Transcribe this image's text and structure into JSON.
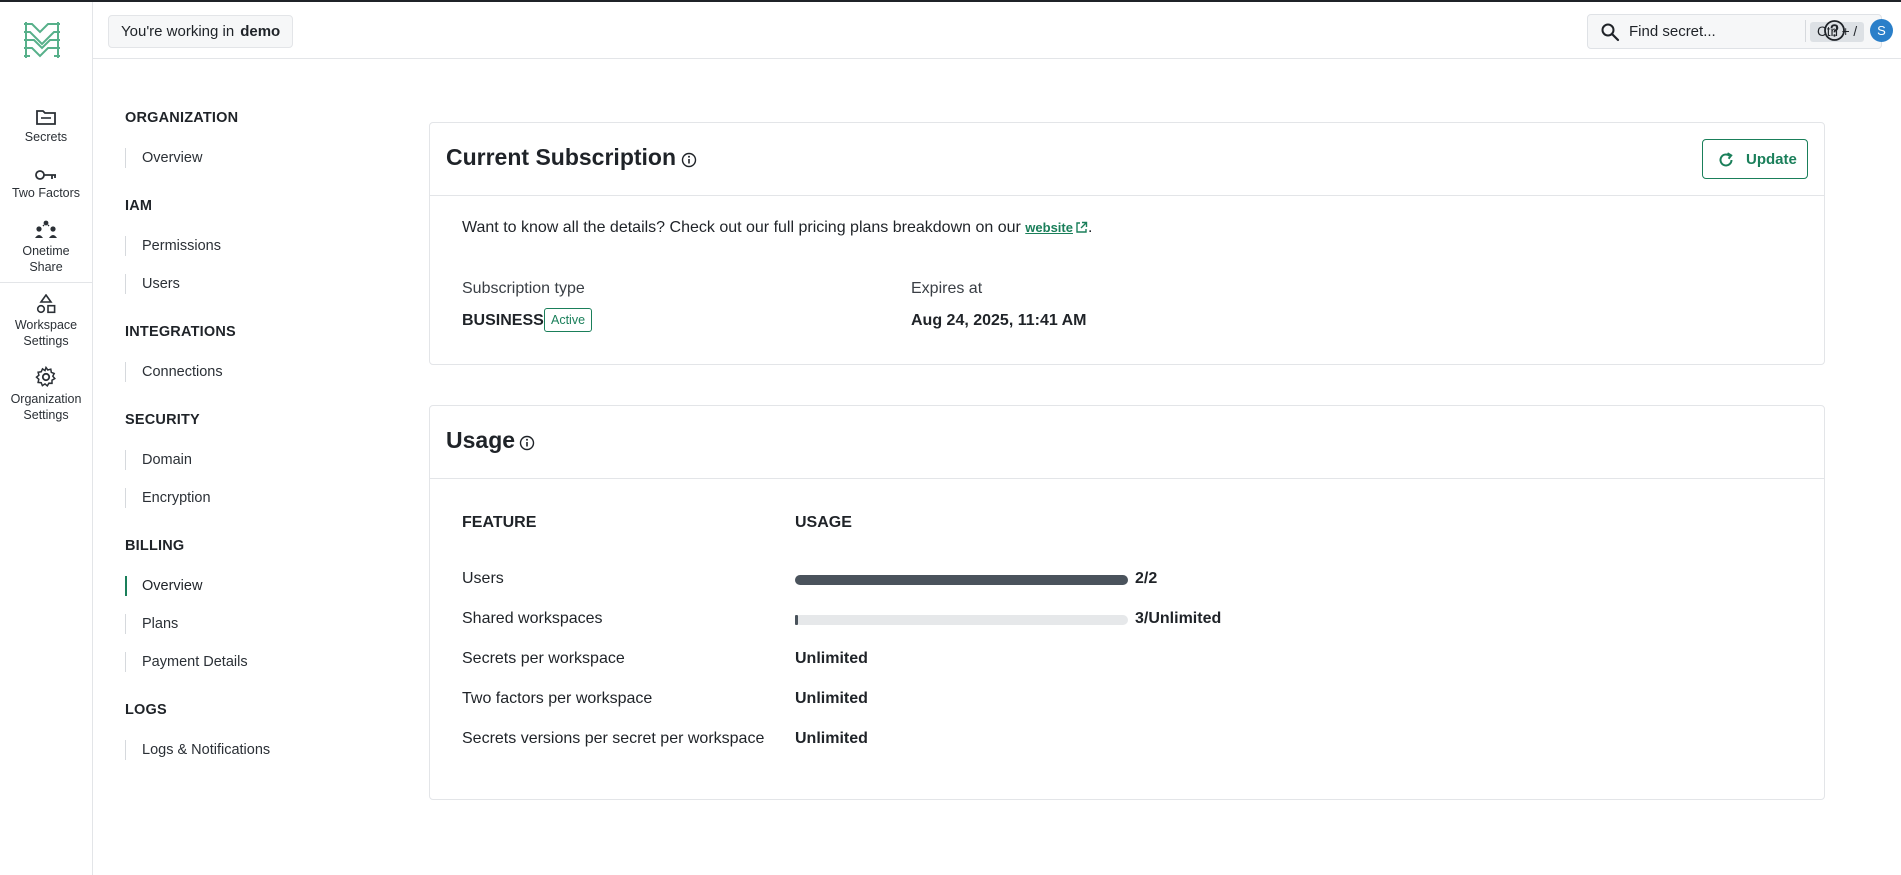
{
  "header": {
    "workspace_prefix": "You're working in",
    "workspace_name": "demo",
    "search_placeholder": "Find secret...",
    "search_shortcut": "Ctrl + /",
    "avatar_initial": "S"
  },
  "rail": {
    "items": [
      {
        "label": "Secrets",
        "icon": "folder-icon"
      },
      {
        "label": "Two Factors",
        "icon": "key-icon"
      },
      {
        "label": "Onetime Share",
        "icon": "users-share-icon"
      },
      {
        "label": "Workspace Settings",
        "icon": "shapes-icon"
      },
      {
        "label": "Organization Settings",
        "icon": "gear-icon"
      }
    ]
  },
  "nav": {
    "groups": [
      {
        "title": "ORGANIZATION",
        "links": [
          "Overview"
        ]
      },
      {
        "title": "IAM",
        "links": [
          "Permissions",
          "Users"
        ]
      },
      {
        "title": "INTEGRATIONS",
        "links": [
          "Connections"
        ]
      },
      {
        "title": "SECURITY",
        "links": [
          "Domain",
          "Encryption"
        ]
      },
      {
        "title": "BILLING",
        "links": [
          "Overview",
          "Plans",
          "Payment Details"
        ]
      },
      {
        "title": "LOGS",
        "links": [
          "Logs & Notifications"
        ]
      }
    ],
    "active": "BILLING / Overview"
  },
  "subscription": {
    "title": "Current Subscription",
    "update_label": "Update",
    "intro_text": "Want to know all the details? Check out our full pricing plans breakdown on our",
    "intro_link": "website",
    "intro_end": ".",
    "type_label": "Subscription type",
    "type_value": "BUSINESS",
    "status_badge": "Active",
    "expires_label": "Expires at",
    "expires_value": "Aug 24, 2025, 11:41 AM"
  },
  "usage": {
    "title": "Usage",
    "col_feature": "FEATURE",
    "col_usage": "USAGE",
    "rows": [
      {
        "feature": "Users",
        "value": "2/2",
        "progress": 1.0
      },
      {
        "feature": "Shared workspaces",
        "value": "3/Unlimited",
        "progress": 0.01
      },
      {
        "feature": "Secrets per workspace",
        "value": "Unlimited"
      },
      {
        "feature": "Two factors per workspace",
        "value": "Unlimited"
      },
      {
        "feature": "Secrets versions per secret per workspace",
        "value": "Unlimited"
      }
    ]
  },
  "colors": {
    "accent": "#1a7f5a",
    "progress_fill": "#4a535c",
    "progress_track": "#e6e8ea",
    "avatar": "#2a7fc9"
  }
}
